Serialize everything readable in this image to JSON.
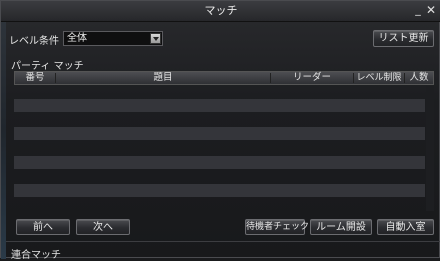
{
  "window": {
    "title": "マッチ",
    "minimize_glyph": "_",
    "close_glyph": "✕"
  },
  "filter": {
    "label": "レベル条件",
    "selected": "全体"
  },
  "buttons": {
    "list_refresh": "リスト更新",
    "prev": "前へ",
    "next": "次へ",
    "waiting_check": "待機者チェック",
    "room_open": "ルーム開設",
    "auto_enter": "自動入室"
  },
  "party_section": {
    "title": "パーティ マッチ",
    "columns": [
      "番号",
      "題目",
      "リーダー",
      "レベル制限",
      "人数"
    ],
    "rows": []
  },
  "union_section": {
    "title": "連合マッチ"
  },
  "colors": {
    "background": "#1a1b1d",
    "row_alt": "#34353a",
    "text": "#e4e4e4"
  }
}
